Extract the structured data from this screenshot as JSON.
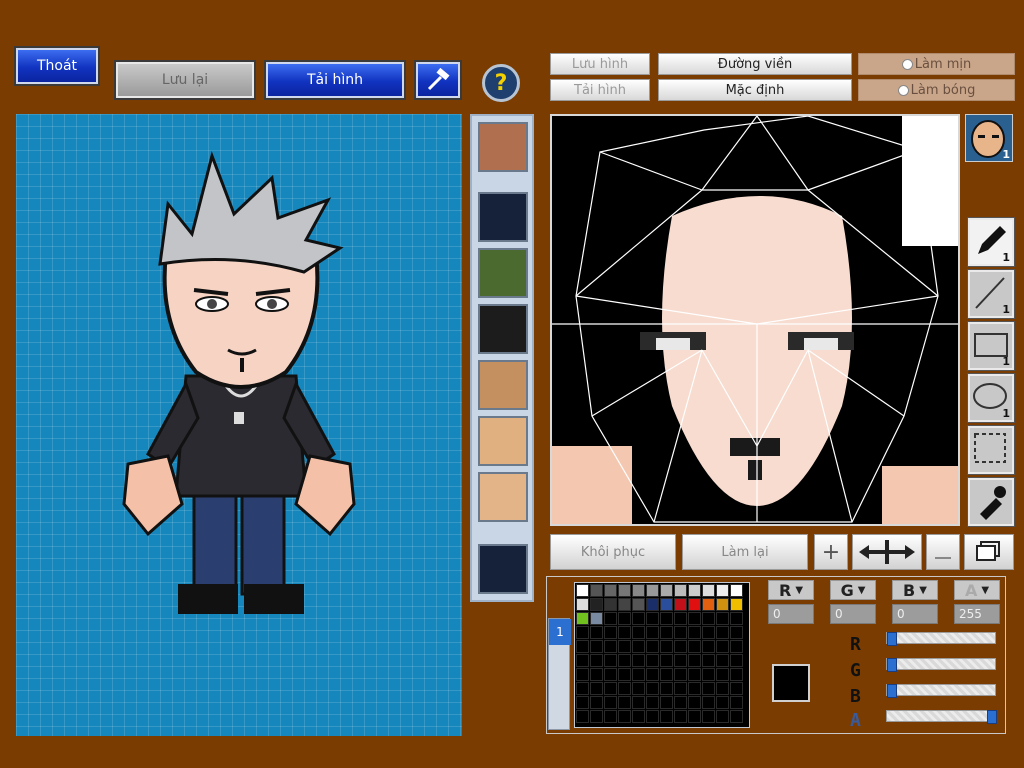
{
  "toolbar": {
    "exit_label": "Thoát",
    "save_label": "Lưu lại",
    "reload_label": "Tải hình",
    "help_label": "?"
  },
  "editor_tabs": {
    "save_image": "Lưu hình",
    "load_image": "Tải hình",
    "outline": "Đường viền",
    "default": "Mặc định",
    "smooth": "Làm mịn",
    "shiny": "Làm bóng"
  },
  "face_preview_badge": "1",
  "tools": [
    {
      "icon": "pen-icon",
      "badge": "1"
    },
    {
      "icon": "line-icon",
      "badge": "1"
    },
    {
      "icon": "rectangle-icon",
      "badge": "1"
    },
    {
      "icon": "ellipse-icon",
      "badge": "1"
    },
    {
      "icon": "selection-icon",
      "badge": ""
    },
    {
      "icon": "eyedropper-icon",
      "badge": ""
    }
  ],
  "controls": {
    "restore_label": "Khôi phục",
    "redo_label": "Làm lại",
    "zoom_label": "+",
    "move_icon": "move-arrows-icon",
    "fit_icon": "window-icon"
  },
  "color": {
    "r_label": "R",
    "g_label": "G",
    "b_label": "B",
    "a_label": "A",
    "r": "0",
    "g": "0",
    "b": "0",
    "a": "255",
    "current_hex": "#000000",
    "palette_tab": "1",
    "swatches": [
      "#ffffff",
      "#555555",
      "#666666",
      "#777777",
      "#888888",
      "#999999",
      "#aaaaaa",
      "#bbbbbb",
      "#cccccc",
      "#dddddd",
      "#eeeeee",
      "#ffffff",
      "#dddddd",
      "#222222",
      "#333333",
      "#444444",
      "#555555",
      "#1a2f6a",
      "#2a4d9c",
      "#c0101a",
      "#e01010",
      "#e06010",
      "#d09010",
      "#f0c000",
      "#70c020",
      "#7a8aa0"
    ]
  },
  "sliders": {
    "r": 0.0,
    "g": 0.0,
    "b": 0.0,
    "a": 1.0
  }
}
